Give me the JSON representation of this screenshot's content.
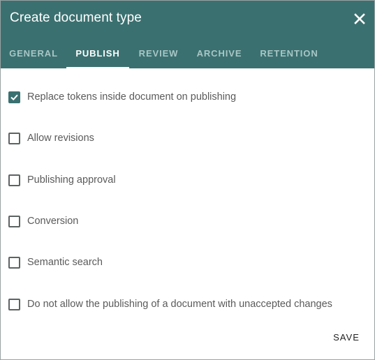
{
  "dialog": {
    "title": "Create document type",
    "close_icon": "close-icon"
  },
  "tabs": [
    {
      "label": "GENERAL",
      "active": false
    },
    {
      "label": "PUBLISH",
      "active": true
    },
    {
      "label": "REVIEW",
      "active": false
    },
    {
      "label": "ARCHIVE",
      "active": false
    },
    {
      "label": "RETENTION",
      "active": false
    }
  ],
  "options": [
    {
      "label": "Replace tokens inside document on publishing",
      "checked": true
    },
    {
      "label": "Allow revisions",
      "checked": false
    },
    {
      "label": "Publishing approval",
      "checked": false
    },
    {
      "label": "Conversion",
      "checked": false
    },
    {
      "label": "Semantic search",
      "checked": false
    },
    {
      "label": "Do not allow the publishing of a document with unaccepted changes",
      "checked": false
    }
  ],
  "footer": {
    "save_label": "SAVE"
  },
  "colors": {
    "header": "#3b7070",
    "tab_inactive": "#a9c6c6",
    "checkbox_checked": "#3b7070"
  }
}
